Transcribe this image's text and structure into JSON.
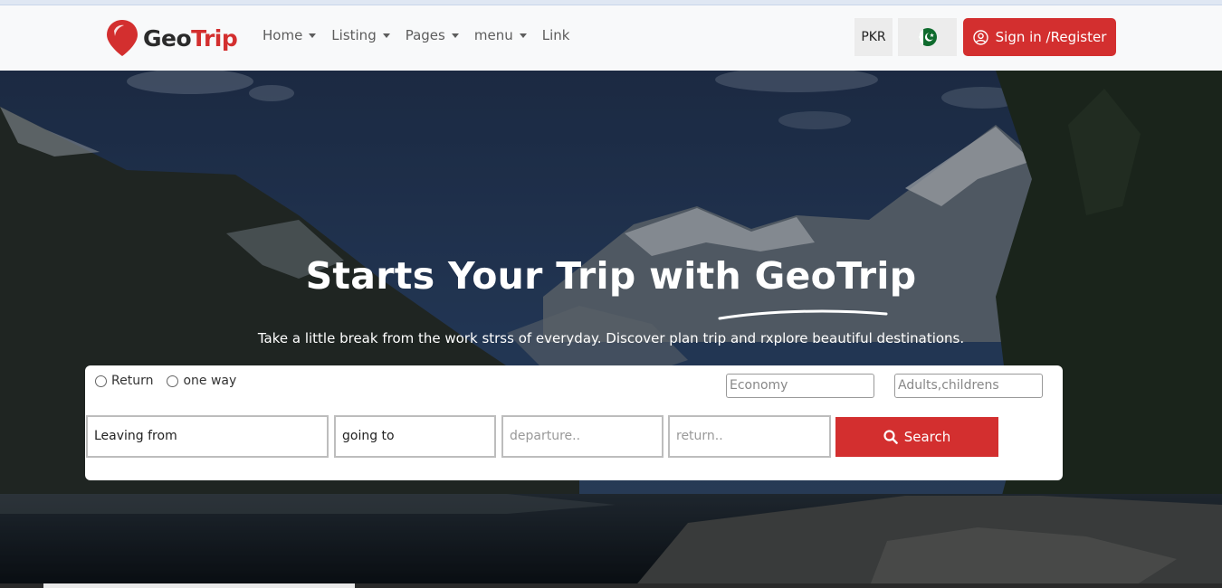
{
  "brand": {
    "name_part1": "Geo",
    "name_part2": "Trip"
  },
  "nav": {
    "items": [
      {
        "label": "Home",
        "dropdown": true
      },
      {
        "label": "Listing",
        "dropdown": true
      },
      {
        "label": "Pages",
        "dropdown": true
      },
      {
        "label": "menu",
        "dropdown": true
      },
      {
        "label": "Link",
        "dropdown": false
      }
    ],
    "currency": "PKR",
    "flag_icon": "pakistan-flag-icon",
    "signin_label": "Sign in /Register"
  },
  "hero": {
    "title": "Starts Your Trip with GeoTrip",
    "subtitle": "Take a little break from the work strss of everyday. Discover plan trip and rxplore beautiful destinations."
  },
  "search": {
    "trip_types": [
      "Return",
      "one way"
    ],
    "class_placeholder": "Economy",
    "passengers_placeholder": "Adults,childrens",
    "leaving_value": "Leaving from",
    "going_value": "going to",
    "departure_placeholder": "departure..",
    "return_placeholder": "return..",
    "search_label": "Search"
  },
  "colors": {
    "accent": "#d32f2f",
    "navbar_bg": "#f8f9fa"
  }
}
